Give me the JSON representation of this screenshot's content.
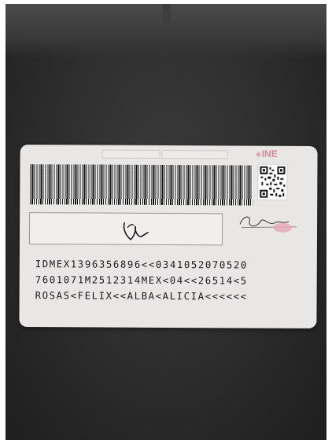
{
  "card": {
    "issuer_logo": "INE",
    "mrz": [
      "IDMEX1396356896<<0341052070520",
      "7601071M2512314MEX<04<<26514<5",
      "ROSAS<FELIX<<ALBA<ALICIA<<<<<<"
    ]
  },
  "colors": {
    "background": "#2f2f2f",
    "card": "#e9e6e6",
    "logo": "#d6869c",
    "mrz_text": "#1b1b1b"
  },
  "icons": [
    "barcode-icon",
    "qr-code-icon",
    "signature-icon"
  ]
}
